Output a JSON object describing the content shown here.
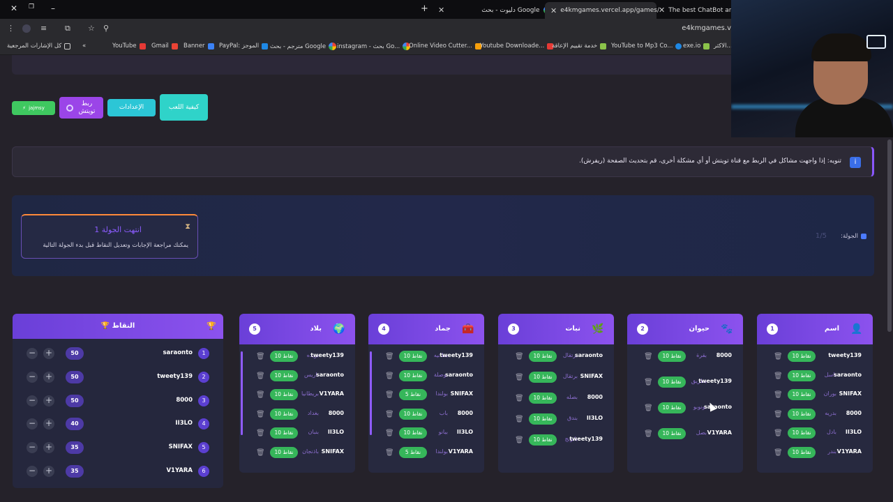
{
  "browser": {
    "tabs": [
      {
        "title": "The best ChatBot and Wi",
        "active": false
      },
      {
        "title": "e4kmgames.vercel.app/games/",
        "active": true
      },
      {
        "title": "دليوت - بحث Google",
        "active": false
      }
    ],
    "url": "e4kmgames.v",
    "bookmarks": [
      {
        "label": "كل الإشارات المرجعية",
        "color": "#caa54a"
      },
      {
        "label": "YouTube",
        "color": "#e53935"
      },
      {
        "label": "Gmail",
        "color": "#ea4335"
      },
      {
        "label": "Banner",
        "color": "#3b82f6"
      },
      {
        "label": "PayPal: الموجز",
        "color": "#1e88e5"
      },
      {
        "label": "مترجم - بحث Google",
        "color": "#4285f4"
      },
      {
        "label": "instagram - بحث Go...",
        "color": "#4285f4"
      },
      {
        "label": "Online Video Cutter...",
        "color": "#f59e0b"
      },
      {
        "label": "Youtube Downloade...",
        "color": "#e53935"
      },
      {
        "label": "خدمة تقييم الإعاقة",
        "color": "#8bc34a"
      },
      {
        "label": "YouTube to Mp3 Co...",
        "color": "#1e88e5"
      },
      {
        "label": "exe.io",
        "color": "#8bc34a"
      },
      {
        "label": "الاكثر...",
        "color": "#999999"
      }
    ]
  },
  "toolbar": {
    "how_to_play": "كيفية اللعب",
    "settings": "الإعدادات",
    "link_twitch": "ربط تويتش",
    "jmsy": "jajmsy"
  },
  "notice": {
    "text": "تنويه: إذا واجهت مشاكل في الربط مع قناة تويتش أو أي مشكلة أخرى، قم بتحديث الصفحة (ريفرش).",
    "icon": "info-icon"
  },
  "round": {
    "ended_title": "انتهت الجولة 1",
    "ended_sub": "يمكنك مراجعة الإجابات وتعديل النقاط قبل بدء الجولة التالية",
    "label": "الجولة:",
    "counter": "1/5"
  },
  "points_panel": {
    "title": "النقاط",
    "players": [
      {
        "rank": "1",
        "name": "saraonto",
        "score": "50"
      },
      {
        "rank": "2",
        "name": "tweety139",
        "score": "50"
      },
      {
        "rank": "3",
        "name": "8000",
        "score": "50"
      },
      {
        "rank": "4",
        "name": "II3LO",
        "score": "40"
      },
      {
        "rank": "5",
        "name": "SNIFAX",
        "score": "35"
      },
      {
        "rank": "6",
        "name": "V1YARA",
        "score": "35"
      }
    ]
  },
  "categories": [
    {
      "name": "اسم",
      "number": "1",
      "icon": "person-icon",
      "answers": [
        {
          "user": "tweety139",
          "word": "",
          "points": "10 نقاط"
        },
        {
          "user": "saraonto",
          "word": "باسل",
          "points": "10 نقاط"
        },
        {
          "user": "SNIFAX",
          "word": "بوران",
          "points": "10 نقاط"
        },
        {
          "user": "8000",
          "word": "بدريه",
          "points": "10 نقاط"
        },
        {
          "user": "II3LO",
          "word": "بادل",
          "points": "10 نقاط"
        },
        {
          "user": "V1YARA",
          "word": "بندر",
          "points": "10 نقاط"
        }
      ]
    },
    {
      "name": "حيوان",
      "number": "2",
      "icon": "paw-icon",
      "answers": [
        {
          "user": "8000",
          "word": "بقرة",
          "points": "10 نقاط"
        },
        {
          "user": "tweety139",
          "word": "بطريق",
          "points": "10 نقاط"
        },
        {
          "user": "saraonto",
          "word": "بونوبو",
          "points": "10 نقاط"
        },
        {
          "user": "V1YARA",
          "word": "بصل",
          "points": "10 نقاط"
        }
      ]
    },
    {
      "name": "نبات",
      "number": "3",
      "icon": "leaf-icon",
      "answers": [
        {
          "user": "saraonto",
          "word": "برتقال",
          "points": "10 نقاط"
        },
        {
          "user": "SNIFAX",
          "word": "برتقال",
          "points": "10 نقاط"
        },
        {
          "user": "8000",
          "word": "بصله",
          "points": "10 نقاط"
        },
        {
          "user": "II3LO",
          "word": "بندق",
          "points": "10 نقاط"
        },
        {
          "user": "tweety139",
          "word": "بابونج",
          "points": "10 نقاط"
        }
      ]
    },
    {
      "name": "جماد",
      "number": "4",
      "icon": "toolbox-icon",
      "answers": [
        {
          "user": "tweety139",
          "word": "بطانيه",
          "points": "10 نقاط"
        },
        {
          "user": "saraonto",
          "word": "بوصلة",
          "points": "10 نقاط"
        },
        {
          "user": "SNIFAX",
          "word": "بولندا",
          "points": "5 نقاط"
        },
        {
          "user": "8000",
          "word": "باب",
          "points": "10 نقاط"
        },
        {
          "user": "II3LO",
          "word": "بيانو",
          "points": "10 نقاط"
        },
        {
          "user": "V1YARA",
          "word": "بولندا",
          "points": "5 نقاط"
        }
      ]
    },
    {
      "name": "بلاد",
      "number": "5",
      "icon": "globe-icon",
      "answers": [
        {
          "user": "tweety139",
          "word": "بريده",
          "points": "10 نقاط"
        },
        {
          "user": "saraonto",
          "word": "باريس",
          "points": "10 نقاط"
        },
        {
          "user": "V1YARA",
          "word": "بريطانيا",
          "points": "10 نقاط"
        },
        {
          "user": "8000",
          "word": "بغداد",
          "points": "10 نقاط"
        },
        {
          "user": "II3LO",
          "word": "بنبان",
          "points": "10 نقاط"
        },
        {
          "user": "SNIFAX",
          "word": "باذنجان",
          "points": "10 نقاط"
        }
      ]
    }
  ],
  "colors": {
    "accent": "#8c52ee",
    "points_badge": "#36b65a",
    "teal": "#2fd3c9",
    "twitch": "#9b45e8"
  }
}
